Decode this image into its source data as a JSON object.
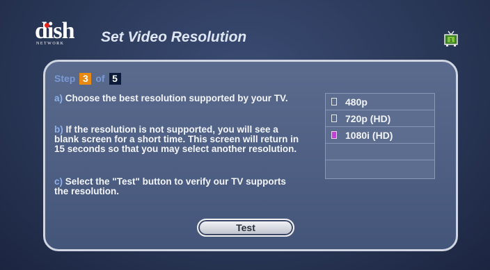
{
  "header": {
    "logo_word": "dish",
    "logo_sub": "NETWORK",
    "title": "Set Video Resolution",
    "tv_icon": "tv-icon"
  },
  "step": {
    "prefix": "Step",
    "current": "3",
    "of": "of",
    "total": "5"
  },
  "instructions": [
    {
      "label": "a)",
      "text": "Choose the best resolution supported by your TV."
    },
    {
      "label": "b)",
      "text": "If the resolution is not supported, you will see a blank screen for a short time. This screen will return in 15 seconds so that you may select another resolution."
    },
    {
      "label": "c)",
      "text": "Select the \"Test\" button to verify our TV supports the resolution."
    }
  ],
  "resolutions": [
    {
      "label": "480p",
      "selected": false
    },
    {
      "label": "720p (HD)",
      "selected": false
    },
    {
      "label": "1080i (HD)",
      "selected": true
    },
    {
      "label": "",
      "selected": false
    },
    {
      "label": "",
      "selected": false
    }
  ],
  "test_button": {
    "label": "Test"
  },
  "colors": {
    "accent_orange": "#e88a12",
    "selected_marker": "#c23fd9",
    "background": "#2a3858"
  }
}
